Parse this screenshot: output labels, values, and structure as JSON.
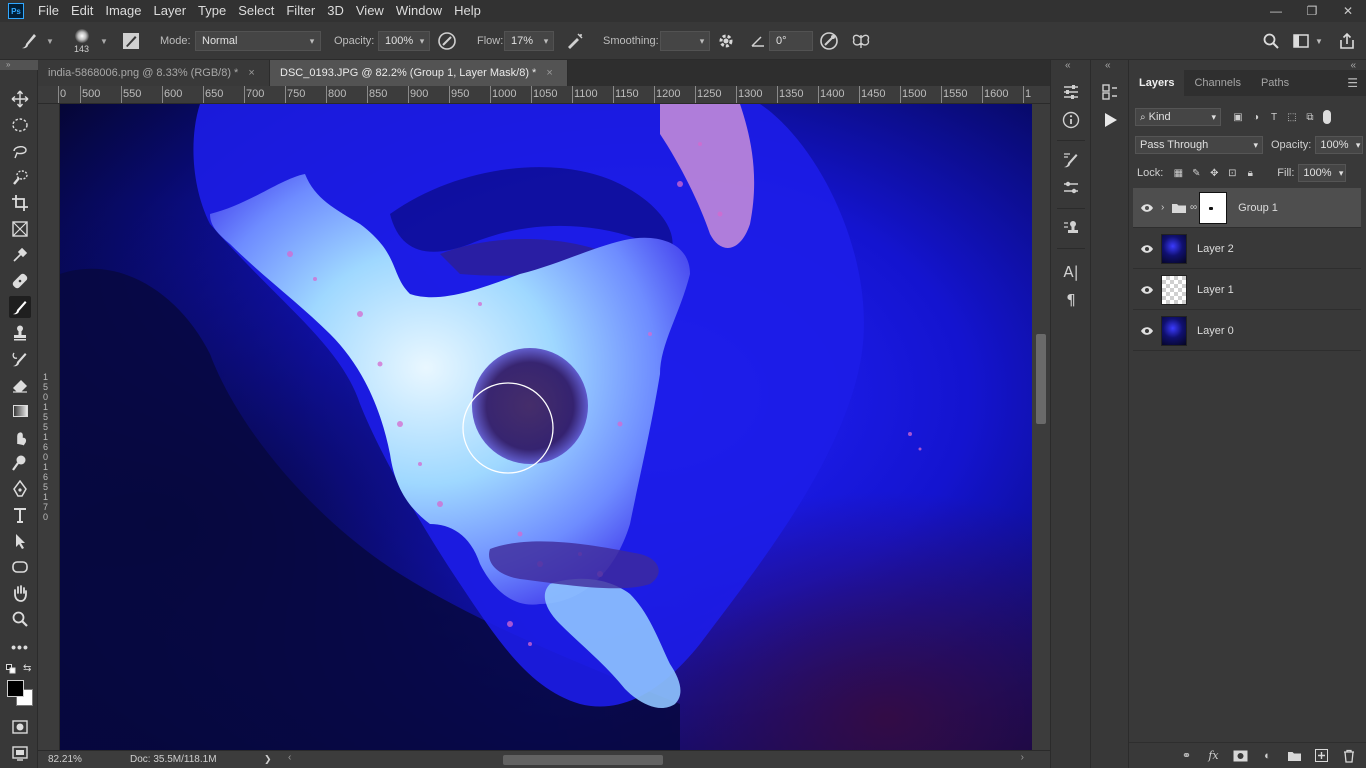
{
  "app": {
    "logo_text": "Ps"
  },
  "menu": [
    "File",
    "Edit",
    "Image",
    "Layer",
    "Type",
    "Select",
    "Filter",
    "3D",
    "View",
    "Window",
    "Help"
  ],
  "window_controls": {
    "minimize": "—",
    "restore": "❐",
    "close": "✕"
  },
  "options": {
    "brush_size": "143",
    "mode_label": "Mode:",
    "mode_value": "Normal",
    "opacity_label": "Opacity:",
    "opacity_value": "100%",
    "flow_label": "Flow:",
    "flow_value": "17%",
    "smoothing_label": "Smoothing:",
    "smoothing_value": "",
    "angle_value": "0°"
  },
  "tabs": [
    {
      "label": "india-5868006.png @ 8.33% (RGB/8) *",
      "close": "×",
      "active": false
    },
    {
      "label": "DSC_0193.JPG @ 82.2% (Group 1, Layer Mask/8) *",
      "close": "×",
      "active": true
    }
  ],
  "ruler": {
    "h_labels": [
      "0",
      "500",
      "550",
      "600",
      "650",
      "700",
      "750",
      "800",
      "850",
      "900",
      "950",
      "1000",
      "1050",
      "1100",
      "1150",
      "1200",
      "1250",
      "1300",
      "1350",
      "1400",
      "1450",
      "1500",
      "1550",
      "1600",
      "1"
    ],
    "v_labels": [
      "1",
      "5",
      "0",
      "1",
      "5",
      "5",
      "1",
      "6",
      "0",
      "1",
      "6",
      "5",
      "1",
      "7",
      "0"
    ]
  },
  "status": {
    "zoom": "82.21%",
    "doc": "Doc: 35.5M/118.1M",
    "arrow": "❯"
  },
  "layers_panel": {
    "tabs": [
      "Layers",
      "Channels",
      "Paths"
    ],
    "filter_kind": "Kind",
    "blend_mode": "Pass Through",
    "opacity_label": "Opacity:",
    "opacity_value": "100%",
    "lock_label": "Lock:",
    "fill_label": "Fill:",
    "fill_value": "100%",
    "layers": [
      {
        "name": "Group 1",
        "type": "group",
        "selected": true
      },
      {
        "name": "Layer 2",
        "type": "image",
        "selected": false
      },
      {
        "name": "Layer 1",
        "type": "transparent",
        "selected": false
      },
      {
        "name": "Layer 0",
        "type": "image",
        "selected": false
      }
    ]
  },
  "colors": {
    "accent": "#31a8ff",
    "face_glow": "#9fd8ff",
    "background_blue": "#1010c8"
  }
}
